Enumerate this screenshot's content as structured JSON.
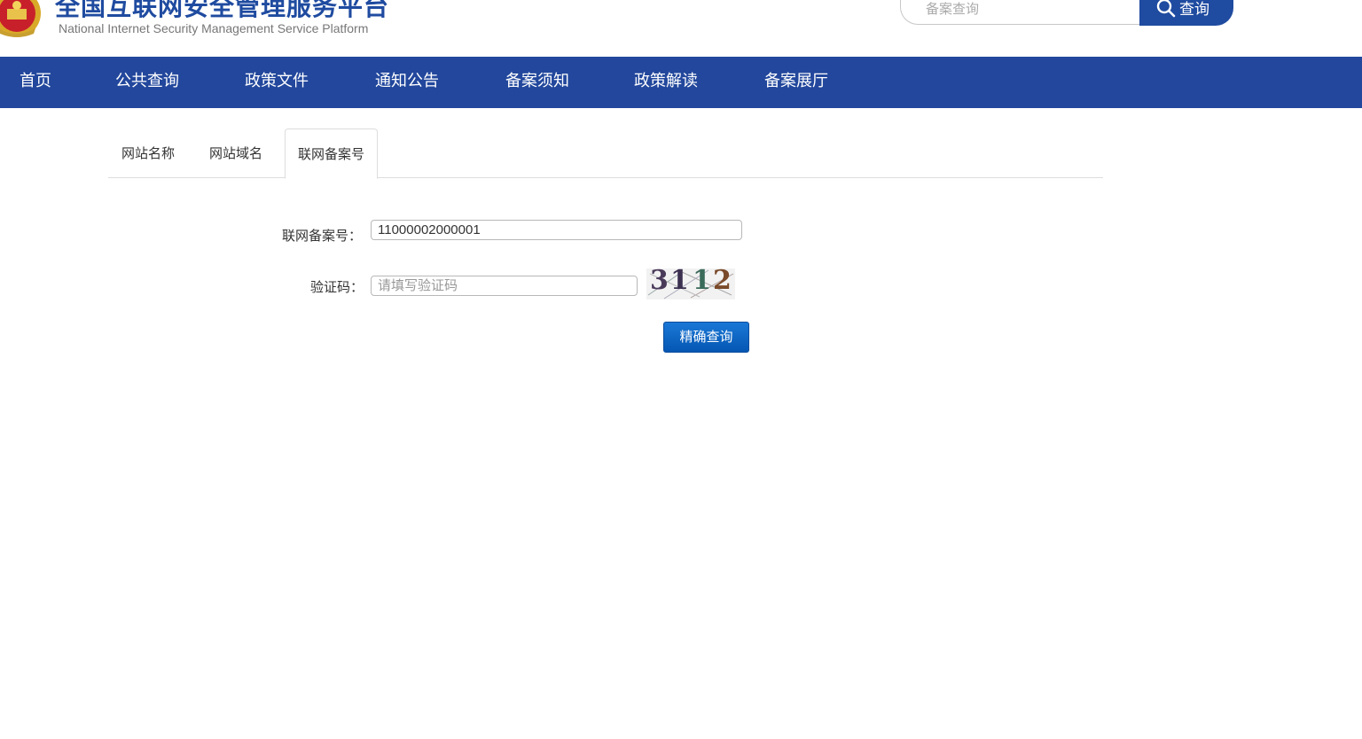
{
  "header": {
    "title_cn": "全国互联网安全管理服务平台",
    "title_en": "National Internet Security Management Service Platform",
    "search_placeholder": "备案查询",
    "search_button": "查询"
  },
  "nav": {
    "items": [
      {
        "label": "首页"
      },
      {
        "label": "公共查询"
      },
      {
        "label": "政策文件"
      },
      {
        "label": "通知公告"
      },
      {
        "label": "备案须知"
      },
      {
        "label": "政策解读"
      },
      {
        "label": "备案展厅"
      }
    ]
  },
  "tabs": [
    {
      "label": "网站名称"
    },
    {
      "label": "网站域名"
    },
    {
      "label": "联网备案号",
      "active": true
    }
  ],
  "form": {
    "record_label": "联网备案号：",
    "record_value": "11000002000001",
    "captcha_label": "验证码：",
    "captcha_placeholder": "请填写验证码",
    "captcha_digits": [
      "3",
      "1",
      "1",
      "2"
    ],
    "submit_label": "精确查询"
  },
  "colors": {
    "brand": "#22479c",
    "title": "#1f4ba0",
    "button": "#0a64c8"
  }
}
